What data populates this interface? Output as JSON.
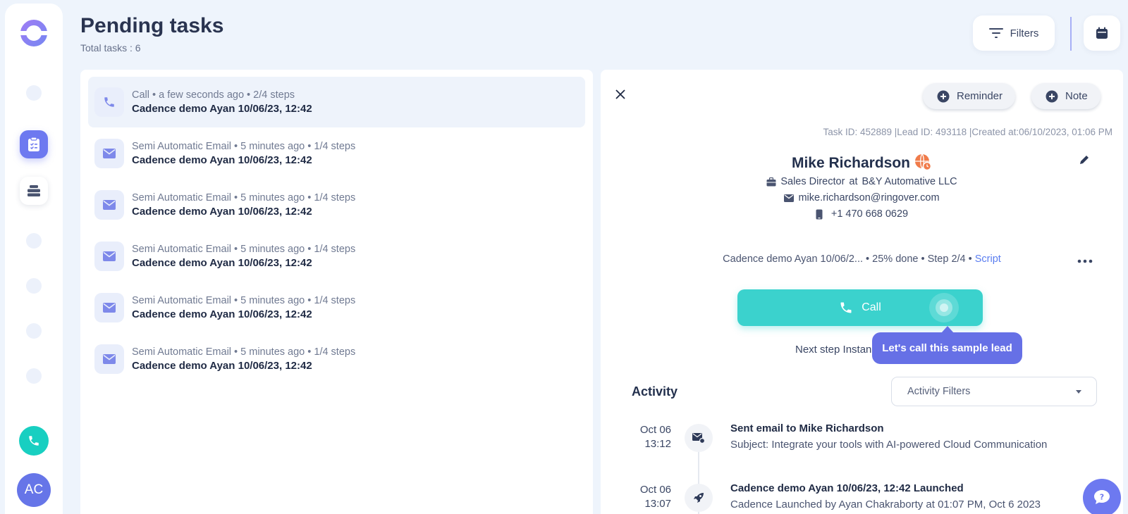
{
  "app": {
    "avatar_initials": "AC"
  },
  "header": {
    "title": "Pending tasks",
    "total_tasks": "Total tasks : 6",
    "filters_label": "Filters"
  },
  "tasks": [
    {
      "meta": "Call • a few seconds ago • 2/4 steps",
      "name": "Cadence demo Ayan 10/06/23, 12:42",
      "type": "call",
      "selected": true
    },
    {
      "meta": "Semi Automatic Email • 5 minutes ago • 1/4 steps",
      "name": "Cadence demo Ayan 10/06/23, 12:42",
      "type": "email"
    },
    {
      "meta": "Semi Automatic Email • 5 minutes ago • 1/4 steps",
      "name": "Cadence demo Ayan 10/06/23, 12:42",
      "type": "email"
    },
    {
      "meta": "Semi Automatic Email • 5 minutes ago • 1/4 steps",
      "name": "Cadence demo Ayan 10/06/23, 12:42",
      "type": "email"
    },
    {
      "meta": "Semi Automatic Email • 5 minutes ago • 1/4 steps",
      "name": "Cadence demo Ayan 10/06/23, 12:42",
      "type": "email"
    },
    {
      "meta": "Semi Automatic Email • 5 minutes ago • 1/4 steps",
      "name": "Cadence demo Ayan 10/06/23, 12:42",
      "type": "email"
    }
  ],
  "detail": {
    "reminder_label": "Reminder",
    "note_label": "Note",
    "ids_line": "Task ID: 452889 |Lead ID: 493118 |Created at:06/10/2023, 01:06 PM",
    "lead": {
      "name": "Mike Richardson",
      "title": "Sales Director",
      "at": "at",
      "company": "B&Y Automative LLC",
      "email": "mike.richardson@ringover.com",
      "phone": "+1 470 668 0629"
    },
    "cadence": {
      "text": "Cadence demo Ayan 10/06/2... • 25% done • Step 2/4 •",
      "script_label": "Script"
    },
    "call_label": "Call",
    "next_step": "Next step Instan",
    "tooltip": "Let's call this sample lead",
    "activity": {
      "title": "Activity",
      "filter_label": "Activity Filters",
      "items": [
        {
          "date": "Oct 06",
          "time": "13:12",
          "title": "Sent email to Mike Richardson",
          "subtitle": "Subject: Integrate your tools with AI-powered Cloud Communication",
          "icon": "mail-send-icon"
        },
        {
          "date": "Oct 06",
          "time": "13:07",
          "title": "Cadence demo Ayan 10/06/23, 12:42 Launched",
          "subtitle": "Cadence Launched by Ayan Chakraborty at 01:07 PM, Oct 6 2023",
          "icon": "rocket-icon"
        }
      ]
    }
  },
  "colors": {
    "accent": "#6d79f0",
    "call": "#3bd2cd",
    "phone_button": "#18cfc1",
    "tooltip": "#6670e6",
    "script_link": "#5a7df0",
    "globe_badge": "#f07b4a"
  }
}
